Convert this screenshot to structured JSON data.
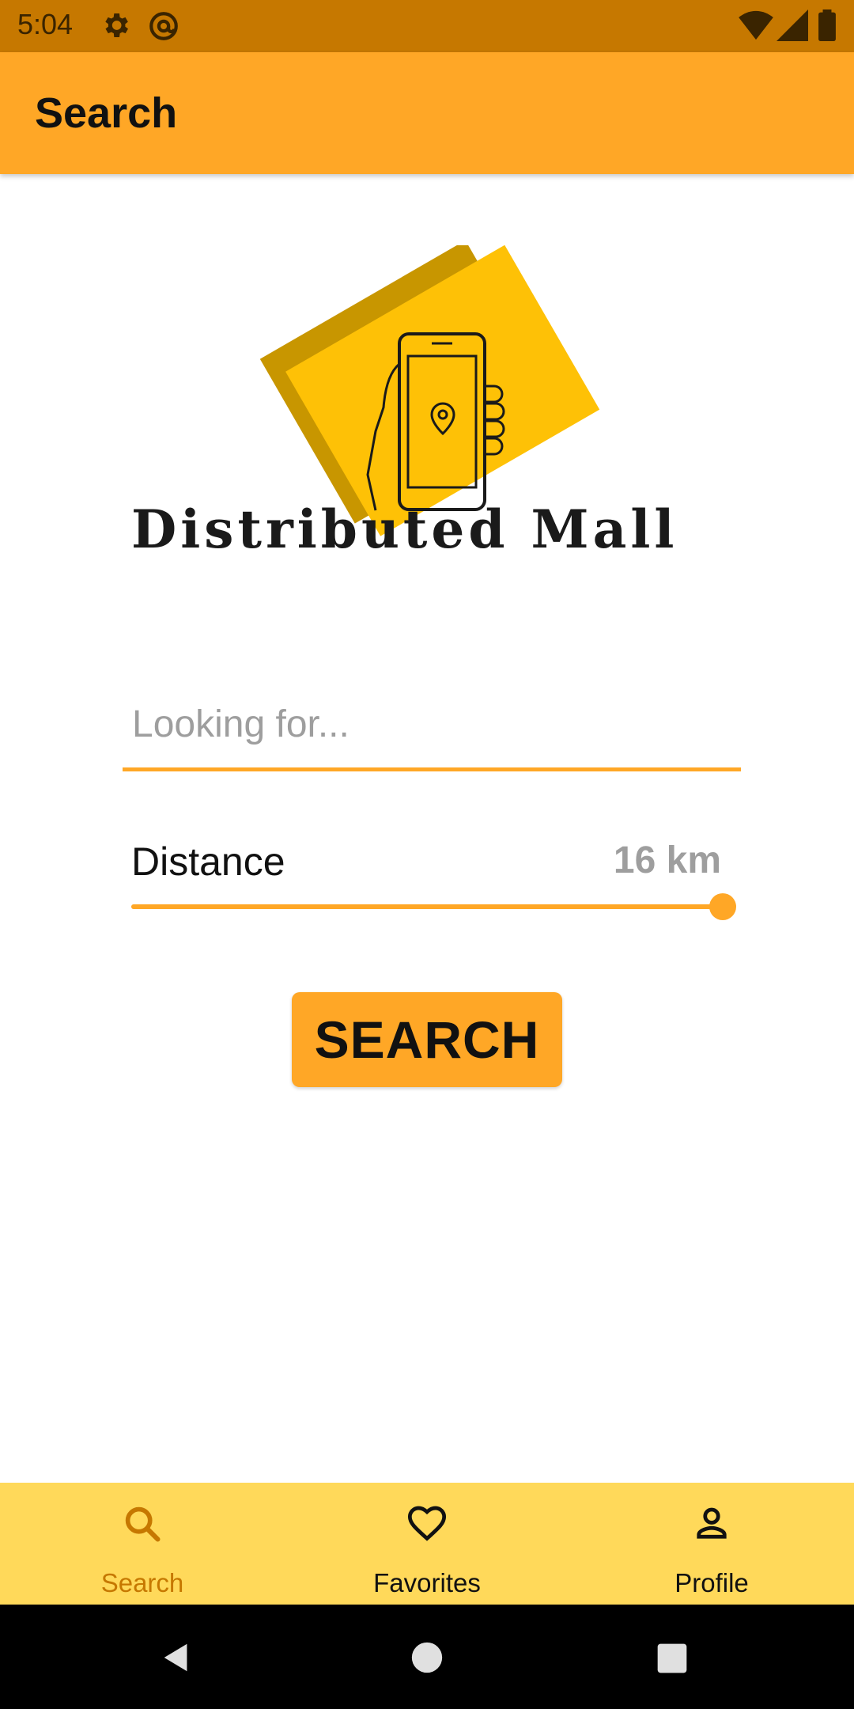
{
  "status_bar": {
    "time": "5:04",
    "icons": [
      "gear-icon",
      "at-sign-icon",
      "wifi-icon",
      "signal-icon",
      "battery-icon"
    ]
  },
  "app_bar": {
    "title": "Search"
  },
  "logo": {
    "text": "Distributed Mall"
  },
  "search": {
    "placeholder": "Looking for...",
    "value": ""
  },
  "distance": {
    "label": "Distance",
    "value_text": "16 km",
    "slider_fraction": 1.0
  },
  "search_button": {
    "label": "SEARCH"
  },
  "bottom_nav": {
    "items": [
      {
        "label": "Search",
        "icon": "search-icon",
        "active": true
      },
      {
        "label": "Favorites",
        "icon": "heart-icon",
        "active": false
      },
      {
        "label": "Profile",
        "icon": "person-icon",
        "active": false
      }
    ]
  },
  "system_nav": {
    "icons": [
      "back-icon",
      "home-icon",
      "recents-icon"
    ]
  },
  "colors": {
    "status_bar": "#c67800",
    "accent": "#ffa726",
    "bottom_nav": "#ffd95a",
    "active_nav": "#c67800"
  }
}
